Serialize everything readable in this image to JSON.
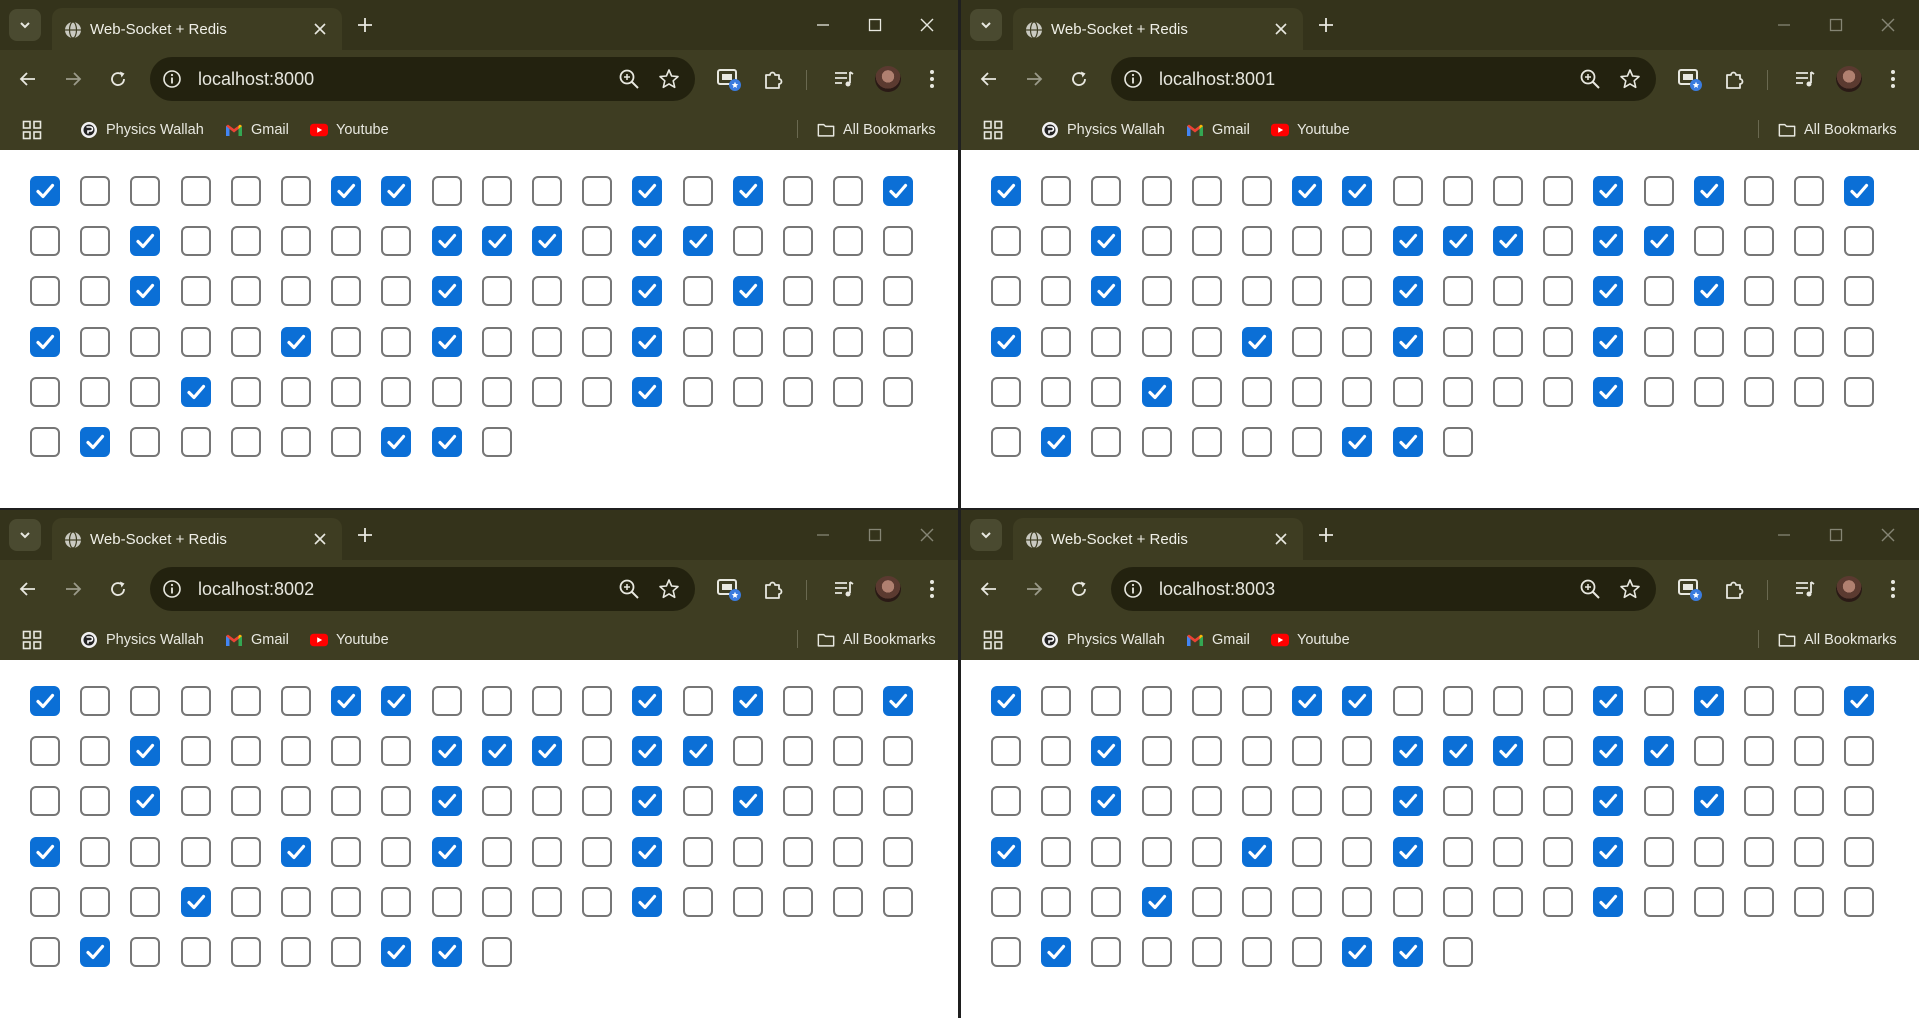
{
  "tab_title": "Web-Socket + Redis",
  "bookmarks": {
    "apps_icon": "apps-grid-icon",
    "items": [
      {
        "label": "Physics Wallah",
        "icon": "physics-wallah-icon"
      },
      {
        "label": "Gmail",
        "icon": "gmail-icon"
      },
      {
        "label": "Youtube",
        "icon": "youtube-icon"
      }
    ],
    "all_bookmarks": "All Bookmarks"
  },
  "windows": [
    {
      "url": "localhost:8000",
      "focused": true
    },
    {
      "url": "localhost:8001",
      "focused": false
    },
    {
      "url": "localhost:8002",
      "focused": false
    },
    {
      "url": "localhost:8003",
      "focused": false
    }
  ],
  "checkbox_columns": 18,
  "checkbox_count": 100,
  "checked_indices": [
    0,
    6,
    7,
    12,
    14,
    17,
    20,
    26,
    27,
    28,
    30,
    31,
    38,
    44,
    48,
    50,
    54,
    59,
    62,
    66,
    75,
    84,
    91,
    97,
    98
  ],
  "colors": {
    "chrome_frame": "#34331b",
    "toolbar": "#3e3d22",
    "omnibox": "#23220f",
    "checkbox_checked": "#0b6fd6",
    "checkbox_border": "#767676",
    "focus_outline": "#2f6fd0"
  }
}
